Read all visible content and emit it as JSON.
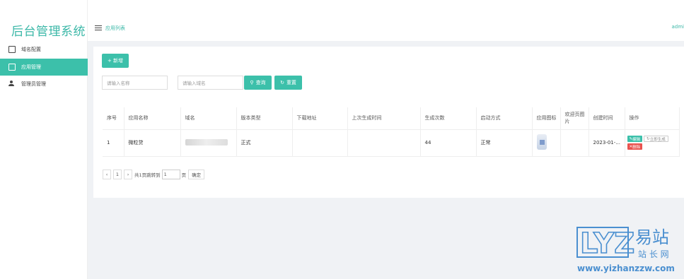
{
  "app_title": "后台管理系统",
  "sidebar": {
    "items": [
      {
        "label": "域名配置",
        "icon": "clipboard-icon"
      },
      {
        "label": "应用管理",
        "icon": "clipboard-icon"
      },
      {
        "label": "管理员管理",
        "icon": "user-icon"
      }
    ]
  },
  "header": {
    "breadcrumb": "应用列表",
    "user": "admi"
  },
  "toolbar": {
    "add_label": "+ 新增",
    "name_placeholder": "请输入名称",
    "domain_placeholder": "请输入域名",
    "search_label": "查询",
    "reset_label": "重置"
  },
  "table": {
    "columns": [
      "序号",
      "应用名称",
      "域名",
      "版本类型",
      "下载地址",
      "上次生成时间",
      "生成次数",
      "启动方式",
      "应用图标",
      "欢迎页图片",
      "创建时间",
      "操作"
    ],
    "rows": [
      {
        "index": "1",
        "name": "微粒贷",
        "domain": "",
        "version": "正式",
        "download": "",
        "last_gen": "",
        "gen_count": "44",
        "launch": "正常",
        "created": "2023-01-...",
        "actions": {
          "edit": "编辑",
          "generate": "立即生成",
          "delete": "删除"
        }
      }
    ]
  },
  "pagination": {
    "prev": "‹",
    "page": "1",
    "next": "›",
    "summary": "共1页跳转到",
    "jump_value": "1",
    "page_unit": "页",
    "confirm": "确定"
  },
  "watermark": {
    "brand_cn": "易站",
    "brand_cn2": "站 长 网",
    "url": "www.yizhanzzw.com",
    "logo_text": "LYZ"
  },
  "colors": {
    "accent": "#3cc0aa",
    "danger": "#e9534f",
    "watermark": "#4a8fd0"
  }
}
